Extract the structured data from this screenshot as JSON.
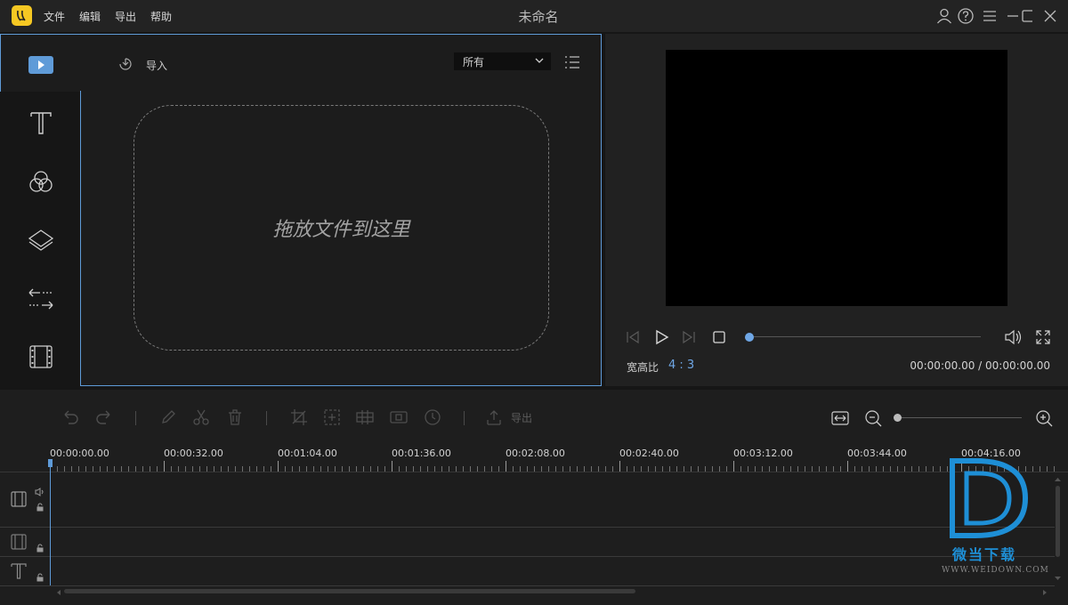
{
  "titlebar": {
    "menu": [
      "文件",
      "编辑",
      "导出",
      "帮助"
    ],
    "title": "未命名"
  },
  "media": {
    "import_label": "导入",
    "filter_value": "所有",
    "drop_text": "拖放文件到这里",
    "rail_items": [
      "media-icon",
      "text-icon",
      "filter-icon",
      "overlay-icon",
      "transition-icon",
      "film-icon"
    ]
  },
  "preview": {
    "aspect_label": "宽高比",
    "aspect_value": "4 : 3",
    "time": "00:00:00.00 / 00:00:00.00",
    "seek_progress": 0
  },
  "timeline": {
    "export_label": "导出",
    "ticks": [
      "00:00:00.00",
      "00:00:32.00",
      "00:01:04.00",
      "00:01:36.00",
      "00:02:08.00",
      "00:02:40.00",
      "00:03:12.00",
      "00:03:44.00",
      "00:04:16.00"
    ]
  },
  "watermark": {
    "text": "微当下载",
    "url": "WWW.WEIDOWN.COM"
  },
  "colors": {
    "accent": "#5f9bd8",
    "logo": "#f6c823",
    "watermark": "#1e8fd6"
  }
}
